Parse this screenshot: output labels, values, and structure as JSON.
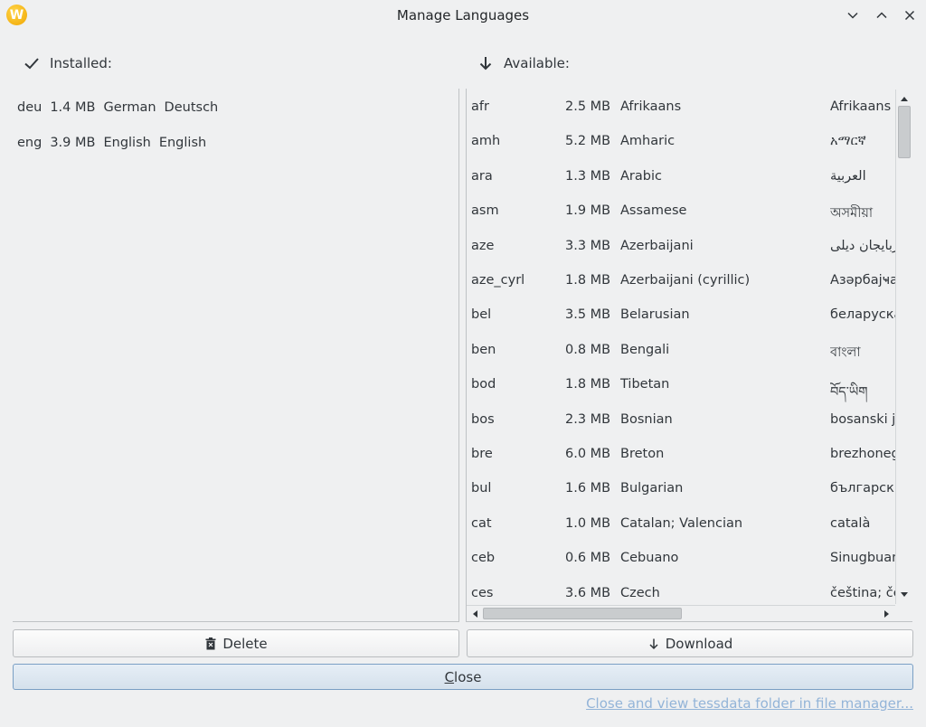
{
  "window": {
    "title": "Manage Languages",
    "app_icon_letter": "W",
    "controls": [
      "chevron-down-icon",
      "chevron-up-icon",
      "close-icon"
    ]
  },
  "installed": {
    "header": "Installed:",
    "header_icon": "checkmark-icon",
    "rows": [
      {
        "code": "deu",
        "size": "1.4 MB",
        "name": "German",
        "native": "Deutsch"
      },
      {
        "code": "eng",
        "size": "3.9 MB",
        "name": "English",
        "native": "English"
      }
    ]
  },
  "available": {
    "header": "Available:",
    "header_icon": "arrow-down-icon",
    "rows": [
      {
        "code": "afr",
        "size": "2.5 MB",
        "name": "Afrikaans",
        "native": "Afrikaans"
      },
      {
        "code": "amh",
        "size": "5.2 MB",
        "name": "Amharic",
        "native": "አማርኛ"
      },
      {
        "code": "ara",
        "size": "1.3 MB",
        "name": "Arabic",
        "native": "العربية"
      },
      {
        "code": "asm",
        "size": "1.9 MB",
        "name": "Assamese",
        "native": "অসমীয়া"
      },
      {
        "code": "aze",
        "size": "3.3 MB",
        "name": "Azerbaijani",
        "native": "آذربایجان دیلی"
      },
      {
        "code": "aze_cyrl",
        "size": "1.8 MB",
        "name": "Azerbaijani (cyrillic)",
        "native": "Азәрбајҹан"
      },
      {
        "code": "bel",
        "size": "3.5 MB",
        "name": "Belarusian",
        "native": "беларуская"
      },
      {
        "code": "ben",
        "size": "0.8 MB",
        "name": "Bengali",
        "native": "বাংলা"
      },
      {
        "code": "bod",
        "size": "1.8 MB",
        "name": "Tibetan",
        "native": "བོད་ཡིག"
      },
      {
        "code": "bos",
        "size": "2.3 MB",
        "name": "Bosnian",
        "native": "bosanski jezik"
      },
      {
        "code": "bre",
        "size": "6.0 MB",
        "name": "Breton",
        "native": "brezhoneg"
      },
      {
        "code": "bul",
        "size": "1.6 MB",
        "name": "Bulgarian",
        "native": "български"
      },
      {
        "code": "cat",
        "size": "1.0 MB",
        "name": "Catalan; Valencian",
        "native": "català"
      },
      {
        "code": "ceb",
        "size": "0.6 MB",
        "name": "Cebuano",
        "native": "Sinugbuanon"
      },
      {
        "code": "ces",
        "size": "3.6 MB",
        "name": "Czech",
        "native": "čeština; český"
      }
    ]
  },
  "buttons": {
    "delete": "Delete",
    "download": "Download",
    "close": "Close"
  },
  "link": "Close and view tessdata folder in file manager...",
  "scroll": {
    "vertical_fraction_scrolled": 0.0,
    "horizontal_fraction_scrolled": 0.0
  }
}
